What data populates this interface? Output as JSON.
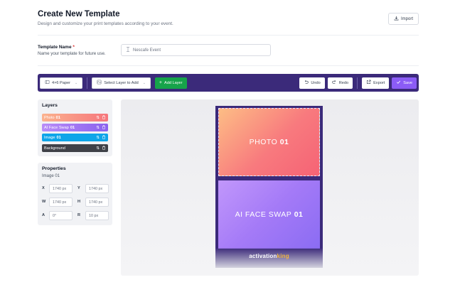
{
  "header": {
    "title": "Create New Template",
    "subtitle": "Design and customize your print templates according to your event.",
    "import_label": "Import"
  },
  "template_name": {
    "label": "Template Name",
    "required_mark": "*",
    "help": "Name your template for future use.",
    "value": "Nescafe Event"
  },
  "toolbar": {
    "paper_size": "4×6 Paper",
    "layer_select_placeholder": "Select Layer to Add",
    "add_layer": "Add Layer",
    "undo": "Undo",
    "redo": "Redo",
    "export": "Export",
    "save": "Save"
  },
  "layers": {
    "title": "Layers",
    "items": [
      {
        "name": "Photo",
        "num": "01",
        "color": "#f6907e"
      },
      {
        "name": "AI Face Swap",
        "num": "01",
        "color": "#9b6cf2"
      },
      {
        "name": "Image",
        "num": "01",
        "color": "#0ea5e9"
      },
      {
        "name": "Background",
        "num": "",
        "color": "#3f4148"
      }
    ]
  },
  "properties": {
    "title": "Properties",
    "selected": "Image 01",
    "x": "1740 px",
    "y": "1740 px",
    "w": "1740 px",
    "h": "1740 px",
    "a": "0°",
    "r": "10 px",
    "labels": {
      "x": "X",
      "y": "Y",
      "w": "W",
      "h": "H",
      "a": "A",
      "r": "R"
    }
  },
  "canvas": {
    "photo_label": "PHOTO",
    "photo_num": "01",
    "face_label": "AI FACE SWAP",
    "face_num": "01",
    "brand_main": "activation",
    "brand_accent": "king"
  },
  "colors": {
    "toolbar_bg": "#3b2a7a",
    "add_layer": "#16a34a",
    "save": "#8b5cf6"
  }
}
